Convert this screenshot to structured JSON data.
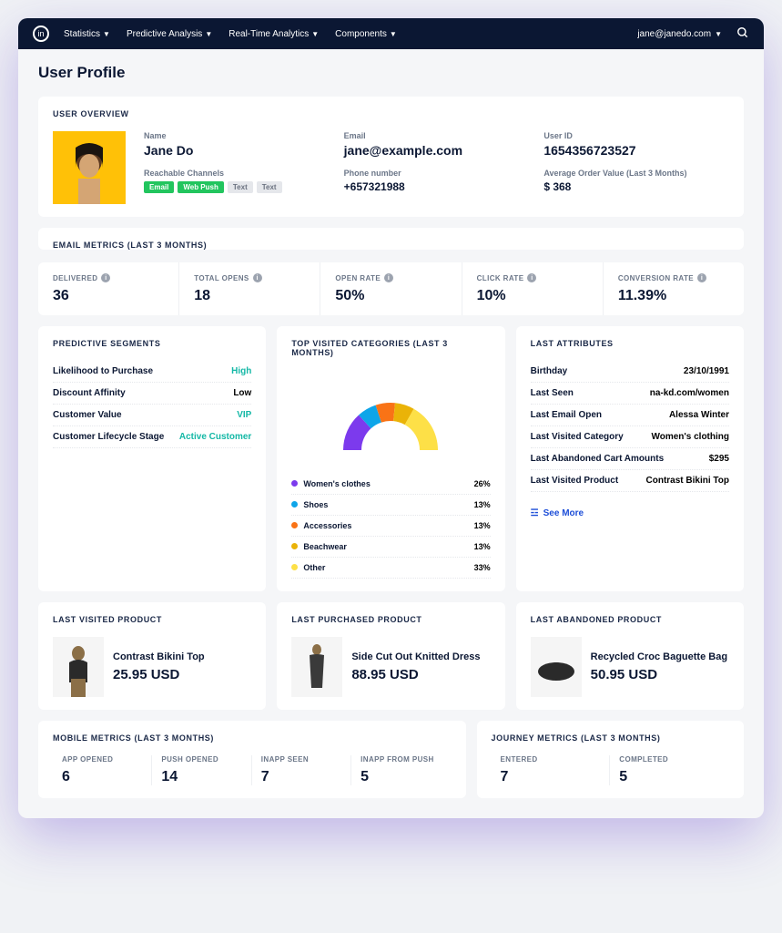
{
  "nav": {
    "items": [
      "Statistics",
      "Predictive Analysis",
      "Real-Time Analytics",
      "Components"
    ],
    "user": "jane@janedo.com"
  },
  "page_title": "User Profile",
  "overview": {
    "title": "USER OVERVIEW",
    "name_label": "Name",
    "name": "Jane Do",
    "channels_label": "Reachable Channels",
    "channels": [
      {
        "t": "Email",
        "c": "green"
      },
      {
        "t": "Web Push",
        "c": "green"
      },
      {
        "t": "Text",
        "c": "gray"
      },
      {
        "t": "Text",
        "c": "gray"
      }
    ],
    "email_label": "Email",
    "email": "jane@example.com",
    "phone_label": "Phone number",
    "phone": "+657321988",
    "uid_label": "User ID",
    "uid": "1654356723527",
    "aov_label": "Average Order Value (Last 3 Months)",
    "aov": "$ 368"
  },
  "email_metrics": {
    "title": "EMAIL METRICS (LAST 3 MONTHS)",
    "items": [
      {
        "label": "DELIVERED",
        "value": "36"
      },
      {
        "label": "TOTAL OPENS",
        "value": "18"
      },
      {
        "label": "OPEN RATE",
        "value": "50%"
      },
      {
        "label": "CLICK RATE",
        "value": "10%"
      },
      {
        "label": "CONVERSION RATE",
        "value": "11.39%"
      }
    ]
  },
  "segments": {
    "title": "PREDICTIVE SEGMENTS",
    "rows": [
      {
        "k": "Likelihood to Purchase",
        "v": "High",
        "cls": "high"
      },
      {
        "k": "Discount Affinity",
        "v": "Low",
        "cls": ""
      },
      {
        "k": "Customer Value",
        "v": "VIP",
        "cls": "vip"
      },
      {
        "k": "Customer Lifecycle Stage",
        "v": "Active Customer",
        "cls": "active"
      }
    ]
  },
  "categories": {
    "title": "TOP VISITED CATEGORIES (LAST 3 MONTHS)",
    "rows": [
      {
        "k": "Women's clothes",
        "v": "26%",
        "c": "#7c3aed"
      },
      {
        "k": "Shoes",
        "v": "13%",
        "c": "#0ea5e9"
      },
      {
        "k": "Accessories",
        "v": "13%",
        "c": "#f97316"
      },
      {
        "k": "Beachwear",
        "v": "13%",
        "c": "#eab308"
      },
      {
        "k": "Other",
        "v": "33%",
        "c": "#fde047"
      }
    ]
  },
  "attributes": {
    "title": "LAST ATTRIBUTES",
    "rows": [
      {
        "k": "Birthday",
        "v": "23/10/1991"
      },
      {
        "k": "Last Seen",
        "v": "na-kd.com/women"
      },
      {
        "k": "Last Email Open",
        "v": "Alessa Winter"
      },
      {
        "k": "Last Visited Category",
        "v": "Women's clothing"
      },
      {
        "k": "Last Abandoned Cart Amounts",
        "v": "$295"
      },
      {
        "k": "Last Visited Product",
        "v": "Contrast Bikini Top"
      }
    ],
    "seemore": "See More"
  },
  "products": {
    "visited": {
      "title": "LAST VISITED PRODUCT",
      "name": "Contrast Bikini Top",
      "price": "25.95 USD"
    },
    "purchased": {
      "title": "LAST PURCHASED PRODUCT",
      "name": "Side Cut Out Knitted Dress",
      "price": "88.95 USD"
    },
    "abandoned": {
      "title": "LAST ABANDONED PRODUCT",
      "name": "Recycled Croc Baguette Bag",
      "price": "50.95 USD"
    }
  },
  "mobile": {
    "title": "MOBILE METRICS (LAST 3 MONTHS)",
    "items": [
      {
        "label": "APP OPENED",
        "value": "6"
      },
      {
        "label": "PUSH OPENED",
        "value": "14"
      },
      {
        "label": "INAPP SEEN",
        "value": "7"
      },
      {
        "label": "INAPP FROM PUSH",
        "value": "5"
      }
    ]
  },
  "journey": {
    "title": "JOURNEY METRICS (LAST 3 MONTHS)",
    "items": [
      {
        "label": "ENTERED",
        "value": "7"
      },
      {
        "label": "COMPLETED",
        "value": "5"
      }
    ]
  },
  "chart_data": {
    "type": "pie",
    "title": "Top Visited Categories (Last 3 Months)",
    "categories": [
      "Women's clothes",
      "Shoes",
      "Accessories",
      "Beachwear",
      "Other"
    ],
    "values": [
      26,
      13,
      13,
      13,
      33
    ],
    "colors": [
      "#7c3aed",
      "#0ea5e9",
      "#f97316",
      "#eab308",
      "#fde047"
    ]
  }
}
